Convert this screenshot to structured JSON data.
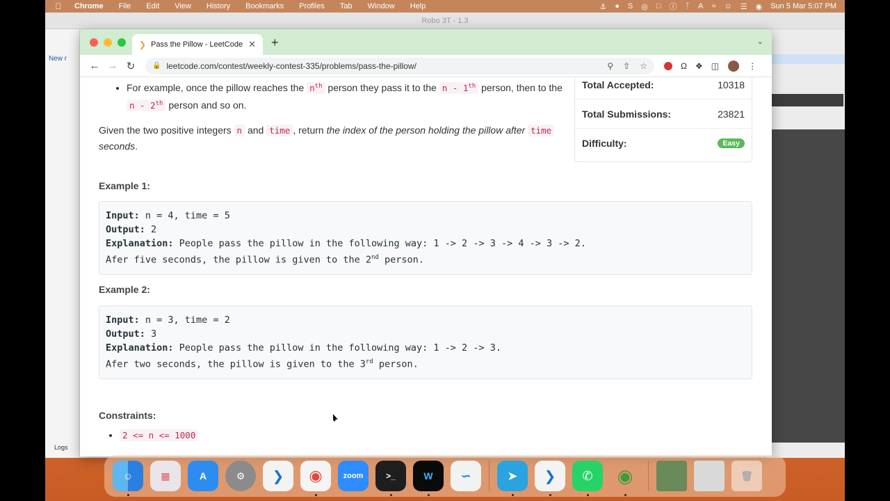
{
  "menubar": {
    "app_name": "Chrome",
    "menus": [
      "File",
      "Edit",
      "View",
      "History",
      "Bookmarks",
      "Profiles",
      "Tab",
      "Window",
      "Help"
    ],
    "clock": "Sun 5 Mar  5:07 PM"
  },
  "robo3t": {
    "title": "Robo 3T - 1.3",
    "new_tab_label": "New r",
    "logs_label": "Logs"
  },
  "browser": {
    "tab_title": "Pass the Pillow - LeetCode Co",
    "url": "leetcode.com/contest/weekly-contest-335/problems/pass-the-pillow/"
  },
  "problem": {
    "bullet_prefix": "For example, once the pillow reaches the ",
    "bullet_code1": "n",
    "bullet_sup1": "th",
    "bullet_mid1": " person they pass it to the ",
    "bullet_code2": "n - 1",
    "bullet_sup2": "th",
    "bullet_mid2": " person, then to the ",
    "bullet_code3": "n - 2",
    "bullet_sup3": "th",
    "bullet_suffix": " person and so on.",
    "desc_prefix": "Given the two positive integers ",
    "desc_code_n": "n",
    "desc_and": " and ",
    "desc_code_time": "time",
    "desc_return": ", return ",
    "desc_italic": "the index of the person holding the pillow after ",
    "desc_code_time2": "time",
    "desc_italic_end": " seconds",
    "desc_period": "."
  },
  "stats": {
    "accepted_label": "Total Accepted:",
    "accepted_value": "10318",
    "submissions_label": "Total Submissions:",
    "submissions_value": "23821",
    "difficulty_label": "Difficulty:",
    "difficulty_value": "Easy",
    "difficulty_color": "#5cb85c"
  },
  "examples": [
    {
      "title": "Example 1:",
      "input_label": "Input:",
      "input": " n = 4, time = 5",
      "output_label": "Output:",
      "output": " 2",
      "explanation_label": "Explanation:",
      "explanation": " People pass the pillow in the following way: 1 -> 2 -> 3 -> 4 -> 3 -> 2.",
      "note": "Afer five seconds, the pillow is given to the 2",
      "note_sup": "nd",
      "note_end": " person."
    },
    {
      "title": "Example 2:",
      "input_label": "Input:",
      "input": " n = 3, time = 2",
      "output_label": "Output:",
      "output": " 3",
      "explanation_label": "Explanation:",
      "explanation": " People pass the pillow in the following way: 1 -> 2 -> 3.",
      "note": "Afer two seconds, the pillow is given to the 3",
      "note_sup": "rd",
      "note_end": " person."
    }
  ],
  "constraints": {
    "title": "Constraints:",
    "items": [
      "2 <= n <= 1000"
    ]
  },
  "dock": {
    "zoom_label": "zoom",
    "terminal_label": ">_"
  }
}
